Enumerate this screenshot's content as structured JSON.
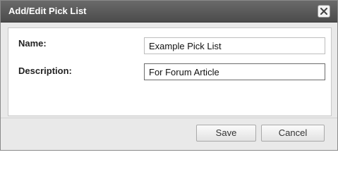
{
  "dialog": {
    "title": "Add/Edit Pick List",
    "close_icon": "close-icon"
  },
  "form": {
    "name_label": "Name:",
    "name_value": "Example Pick List",
    "description_label": "Description:",
    "description_value": "For Forum Article"
  },
  "buttons": {
    "save_label": "Save",
    "cancel_label": "Cancel"
  }
}
